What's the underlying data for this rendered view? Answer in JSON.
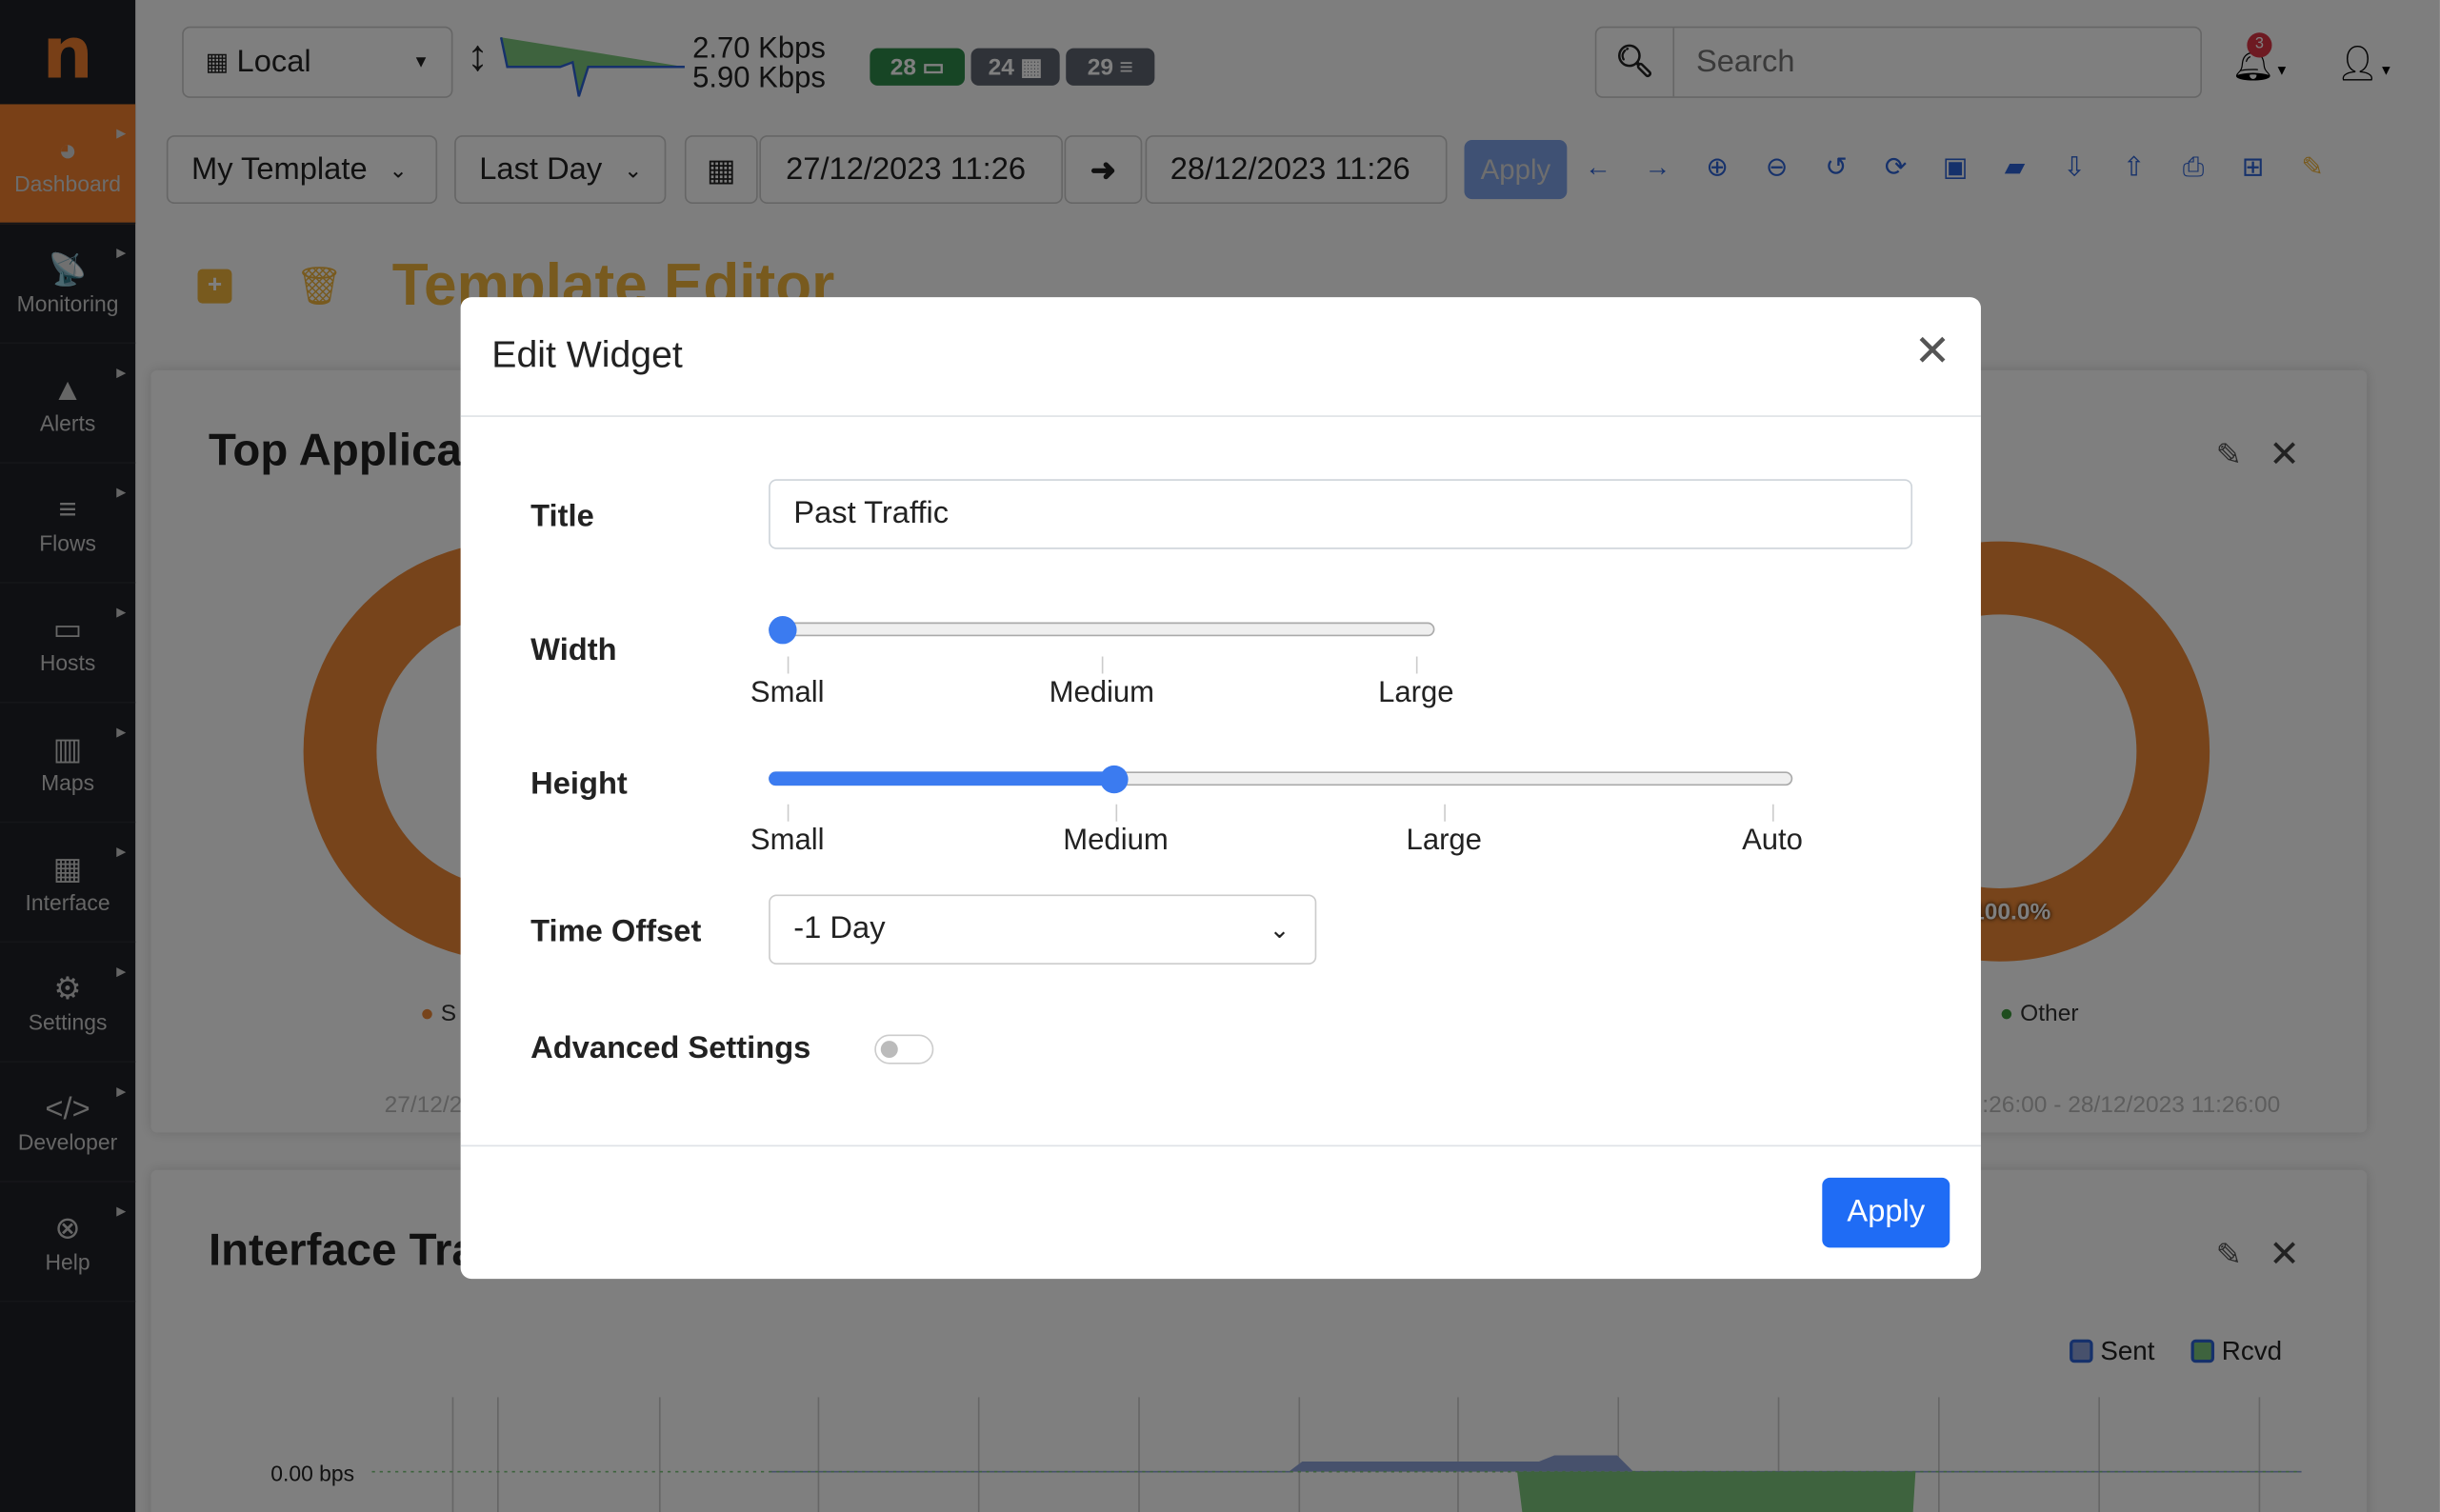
{
  "brand": {
    "logo": "n"
  },
  "sidebar": {
    "items": [
      {
        "label": "Dashboard",
        "icon": "gauge-icon",
        "glyph": "◕",
        "active": true
      },
      {
        "label": "Monitoring",
        "icon": "satellite-dish-icon",
        "glyph": "📡"
      },
      {
        "label": "Alerts",
        "icon": "warning-icon",
        "glyph": "▲"
      },
      {
        "label": "Flows",
        "icon": "bars-icon",
        "glyph": "≡"
      },
      {
        "label": "Hosts",
        "icon": "laptop-icon",
        "glyph": "▭"
      },
      {
        "label": "Maps",
        "icon": "map-icon",
        "glyph": "▥"
      },
      {
        "label": "Interface",
        "icon": "ethernet-icon",
        "glyph": "▦"
      },
      {
        "label": "Settings",
        "icon": "gear-icon",
        "glyph": "⚙"
      },
      {
        "label": "Developer",
        "icon": "code-icon",
        "glyph": "</>"
      },
      {
        "label": "Help",
        "icon": "life-ring-icon",
        "glyph": "⊗"
      }
    ]
  },
  "topbar": {
    "interface": "Local",
    "upload": "2.70 Kbps",
    "download": "5.90 Kbps",
    "badges": [
      {
        "count": "28",
        "icon": "laptop-icon",
        "glyph": "▭",
        "color": "#2f8a4a"
      },
      {
        "count": "24",
        "icon": "ethernet-icon",
        "glyph": "▦",
        "color": "#5f6470"
      },
      {
        "count": "29",
        "icon": "bars-icon",
        "glyph": "≡",
        "color": "#5f6470"
      }
    ],
    "search_placeholder": "Search",
    "notifications": "3"
  },
  "toolbar": {
    "template": "My Template",
    "range": "Last Day",
    "from": "27/12/2023 11:26",
    "to": "28/12/2023 11:26",
    "apply": "Apply",
    "icons": [
      "arrow-left-icon",
      "arrow-right-icon",
      "zoom-in-icon",
      "zoom-out-icon",
      "undo-icon",
      "refresh-icon",
      "save-icon",
      "folder-open-icon",
      "file-download-icon",
      "file-upload-icon",
      "print-icon",
      "folder-plus-icon",
      "edit-icon"
    ]
  },
  "editor": {
    "title": "Template Editor"
  },
  "widget1": {
    "title": "Top Applications",
    "legend_left": "S",
    "legend_right": "Other",
    "pct": "100.0%",
    "footer": "27/12/2023 11:26:00 - 28/12/2023 11:26:00"
  },
  "widget2": {
    "title": "Interface Traffic",
    "legend": [
      "Sent",
      "Rcvd"
    ],
    "ylabel": "0.00 bps"
  },
  "modal": {
    "title": "Edit Widget",
    "title_label": "Title",
    "title_value": "Past Traffic",
    "width_label": "Width",
    "width_options": [
      "Small",
      "Medium",
      "Large"
    ],
    "width_value": "Small",
    "height_label": "Height",
    "height_options": [
      "Small",
      "Medium",
      "Large",
      "Auto"
    ],
    "height_value": "Medium",
    "offset_label": "Time Offset",
    "offset_value": "-1 Day",
    "advanced_label": "Advanced Settings",
    "advanced_enabled": false,
    "apply": "Apply"
  },
  "colors": {
    "accent": "#3b7bf0",
    "brand": "#f3802f",
    "sent": "#8ea3d8",
    "rcvd": "#7cc77c"
  }
}
